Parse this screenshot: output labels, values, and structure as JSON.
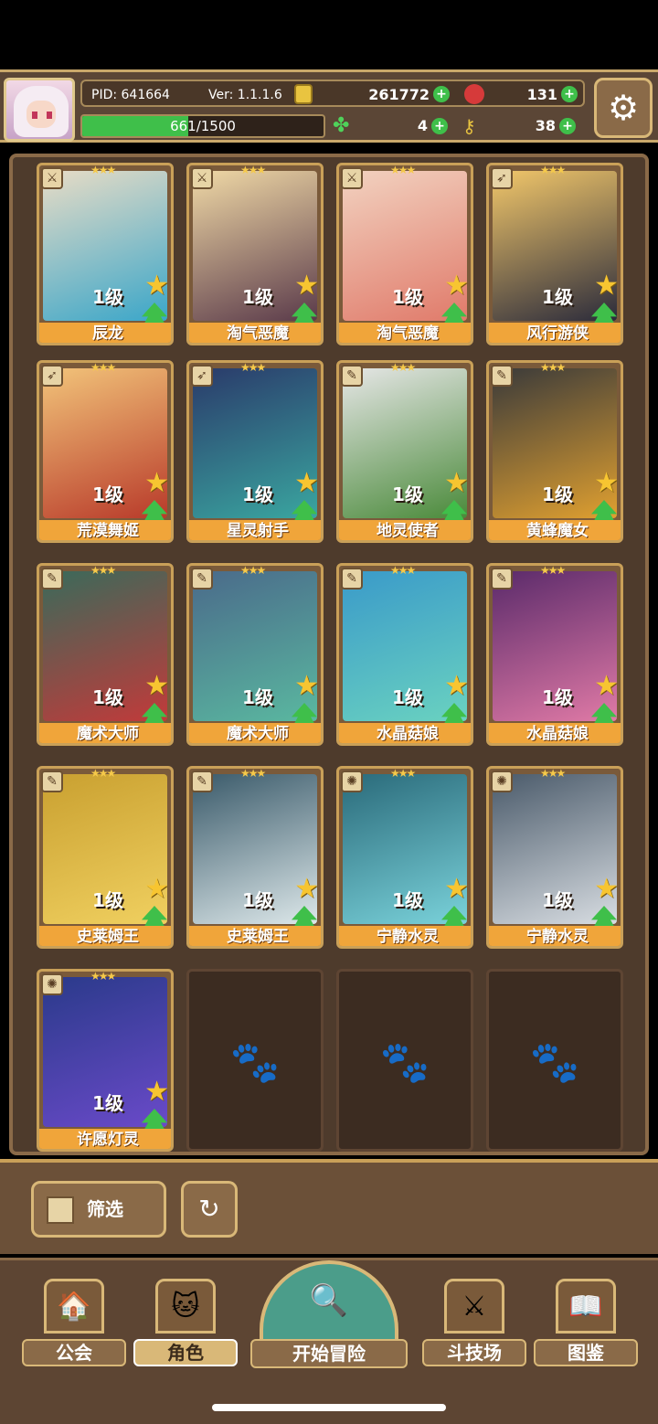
{
  "header": {
    "pid": "PID: 641664",
    "version": "Ver: 1.1.1.6",
    "gold": "261772",
    "gems": "131",
    "exp": "661/1500",
    "exp_fraction": 0.44,
    "clover": "4",
    "keys": "38"
  },
  "cards": [
    {
      "name": "辰龙",
      "level": "1级",
      "type": "sword",
      "colors": [
        "#e8dcc6",
        "#3aa6c9"
      ]
    },
    {
      "name": "淘气恶魔",
      "level": "1级",
      "type": "sword",
      "colors": [
        "#f0d9a6",
        "#5a3a4a"
      ]
    },
    {
      "name": "淘气恶魔",
      "level": "1级",
      "type": "sword",
      "colors": [
        "#f2d2c0",
        "#e07a6a"
      ]
    },
    {
      "name": "风行游侠",
      "level": "1级",
      "type": "bow",
      "colors": [
        "#f2c76a",
        "#2b2b3b"
      ]
    },
    {
      "name": "荒漠舞姬",
      "level": "1级",
      "type": "bow",
      "colors": [
        "#f2c47a",
        "#b83a2a"
      ]
    },
    {
      "name": "星灵射手",
      "level": "1级",
      "type": "bow",
      "colors": [
        "#2a3a6a",
        "#3aa6a0"
      ]
    },
    {
      "name": "地灵使者",
      "level": "1级",
      "type": "staff",
      "colors": [
        "#e6e6e6",
        "#4a8a3a"
      ]
    },
    {
      "name": "黄蜂魔女",
      "level": "1级",
      "type": "staff",
      "colors": [
        "#3a3a3a",
        "#e0a030"
      ]
    },
    {
      "name": "魔术大师",
      "level": "1级",
      "type": "staff",
      "colors": [
        "#3a6a5a",
        "#c23a3a"
      ]
    },
    {
      "name": "魔术大师",
      "level": "1级",
      "type": "staff",
      "colors": [
        "#4a6a8a",
        "#5ab8a0"
      ]
    },
    {
      "name": "水晶菇娘",
      "level": "1级",
      "type": "staff",
      "colors": [
        "#3a9ac9",
        "#6ad2c0"
      ]
    },
    {
      "name": "水晶菇娘",
      "level": "1级",
      "type": "staff",
      "colors": [
        "#5a2a6a",
        "#e07aa6"
      ]
    },
    {
      "name": "史莱姆王",
      "level": "1级",
      "type": "staff",
      "colors": [
        "#c9a030",
        "#f0d060"
      ]
    },
    {
      "name": "史莱姆王",
      "level": "1级",
      "type": "staff",
      "colors": [
        "#3a5a6a",
        "#dde8ea"
      ]
    },
    {
      "name": "宁静水灵",
      "level": "1级",
      "type": "orb",
      "colors": [
        "#2a6a7a",
        "#7ad2da"
      ]
    },
    {
      "name": "宁静水灵",
      "level": "1级",
      "type": "orb",
      "colors": [
        "#4a5a6a",
        "#d8dde2"
      ]
    },
    {
      "name": "许愿灯灵",
      "level": "1级",
      "type": "orb",
      "colors": [
        "#2a3a8a",
        "#6a4ac9"
      ]
    }
  ],
  "empty_slots": 3,
  "controls": {
    "filter_label": "筛选"
  },
  "nav": {
    "guild": "公会",
    "character": "角色",
    "adventure": "开始冒险",
    "arena": "斗技场",
    "codex": "图鉴"
  }
}
